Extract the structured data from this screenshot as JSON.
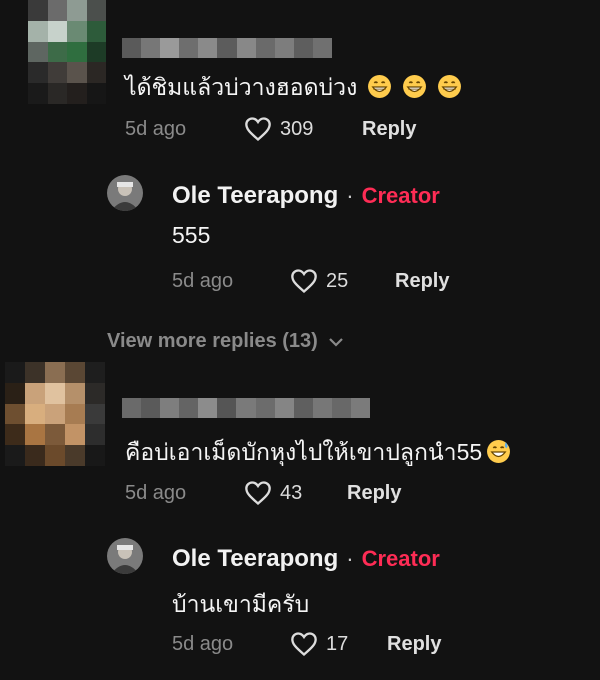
{
  "comments": [
    {
      "text": "ได้ชิมแล้วบ่วางฮอดบ่วง",
      "emojis": [
        "grin-emoji",
        "grin-emoji",
        "grin-emoji"
      ],
      "time": "5d ago",
      "likes": "309",
      "reply_label": "Reply",
      "reply": {
        "author": "Ole Teerapong",
        "separator": "·",
        "badge": "Creator",
        "text": "555",
        "time": "5d ago",
        "likes": "25",
        "reply_label": "Reply"
      },
      "view_more": "View more replies (13)"
    },
    {
      "text": "คือบ่เอาเม็ดบักหุงไปให้เขาปลูกนำ55",
      "emojis": [
        "sweat-grin-emoji"
      ],
      "time": "5d ago",
      "likes": "43",
      "reply_label": "Reply",
      "reply": {
        "author": "Ole Teerapong",
        "separator": "·",
        "badge": "Creator",
        "text": "บ้านเขามีครับ",
        "time": "5d ago",
        "likes": "17",
        "reply_label": "Reply"
      }
    }
  ],
  "colors": {
    "background": "#121212",
    "creator_badge": "#fe2c55",
    "meta": "#8a8a8a"
  }
}
